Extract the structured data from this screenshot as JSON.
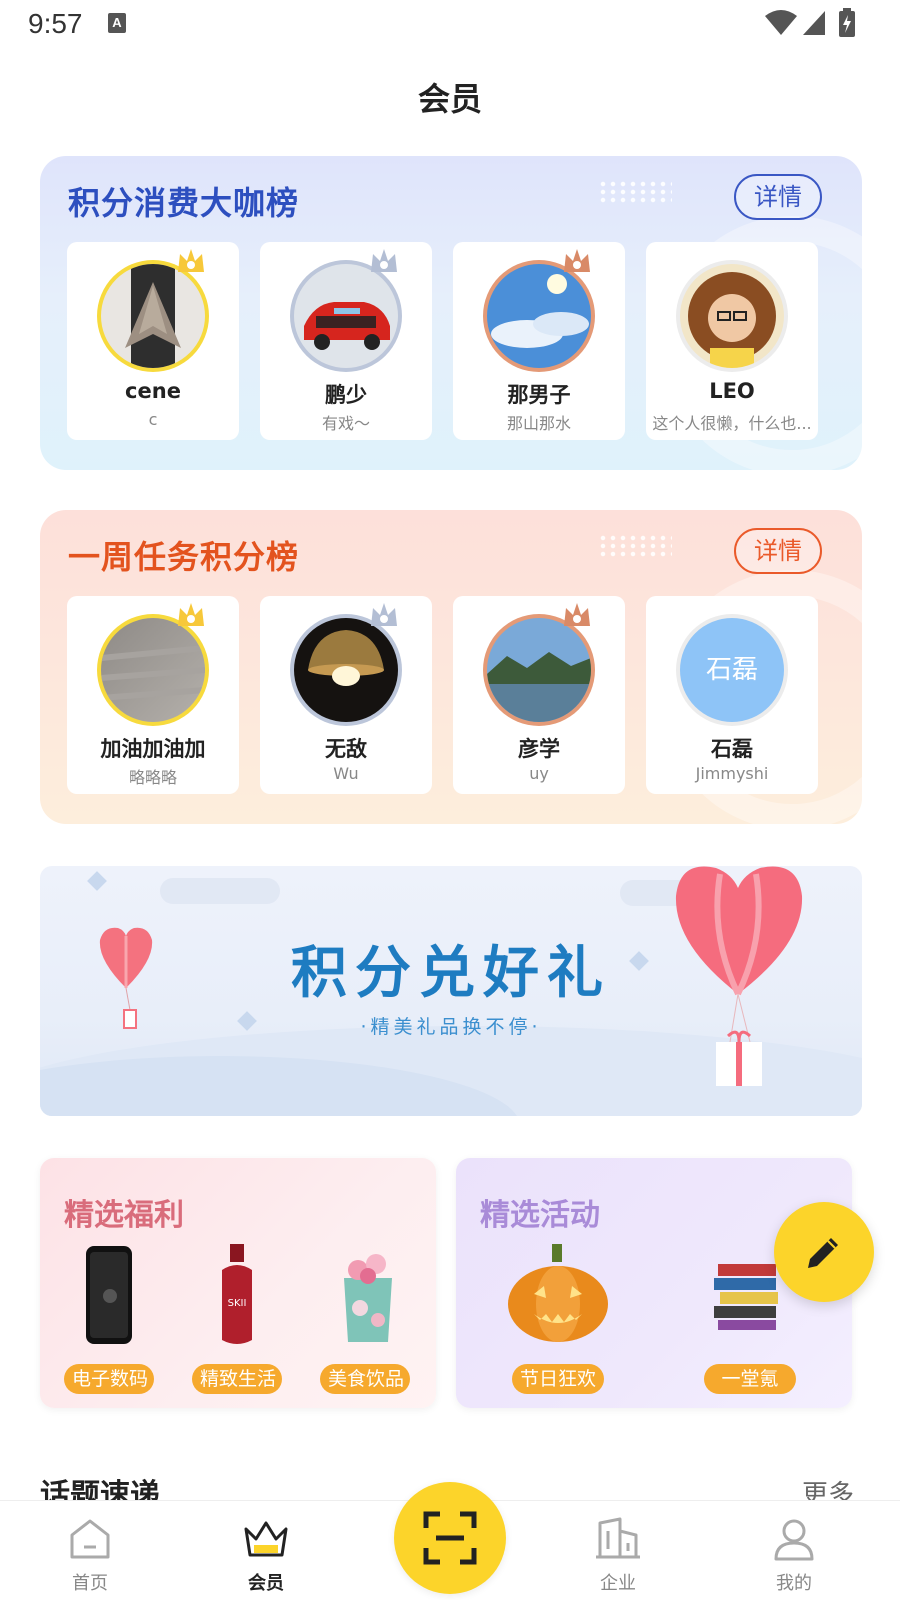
{
  "status": {
    "time": "9:57",
    "a_icon": "A"
  },
  "header": {
    "title": "会员"
  },
  "consumption_rank": {
    "title": "积分消费大咖榜",
    "detail_label": "详情",
    "users": [
      {
        "name": "cene",
        "sub": "c"
      },
      {
        "name": "鹏少",
        "sub": "有戏～"
      },
      {
        "name": "那男子",
        "sub": "那山那水"
      },
      {
        "name": "LEO",
        "sub": "这个人很懒，什么也..."
      }
    ]
  },
  "task_rank": {
    "title": "一周任务积分榜",
    "detail_label": "详情",
    "users": [
      {
        "name": "加油加油加",
        "sub": "略略略"
      },
      {
        "name": "无敌",
        "sub": "Wu"
      },
      {
        "name": "彦学",
        "sub": "uy"
      },
      {
        "name": "石磊",
        "sub": "Jimmyshi",
        "avatar_text": "石磊"
      }
    ]
  },
  "banner": {
    "title": "积分兑好礼",
    "subtitle": "·精美礼品换不停·"
  },
  "benefits": {
    "title": "精选福利",
    "tags": [
      "电子数码",
      "精致生活",
      "美食饮品"
    ]
  },
  "activities": {
    "title": "精选活动",
    "tags": [
      "节日狂欢",
      "一堂氪"
    ]
  },
  "topics": {
    "title": "话题速递",
    "more": "更多"
  },
  "nav": {
    "home": "首页",
    "member": "会员",
    "enterprise": "企业",
    "mine": "我的"
  },
  "colors": {
    "accent_yellow": "#fcd42a",
    "rank_blue": "#2d4fbf",
    "rank_orange": "#e3531e",
    "tag_orange": "#f6a92d"
  }
}
